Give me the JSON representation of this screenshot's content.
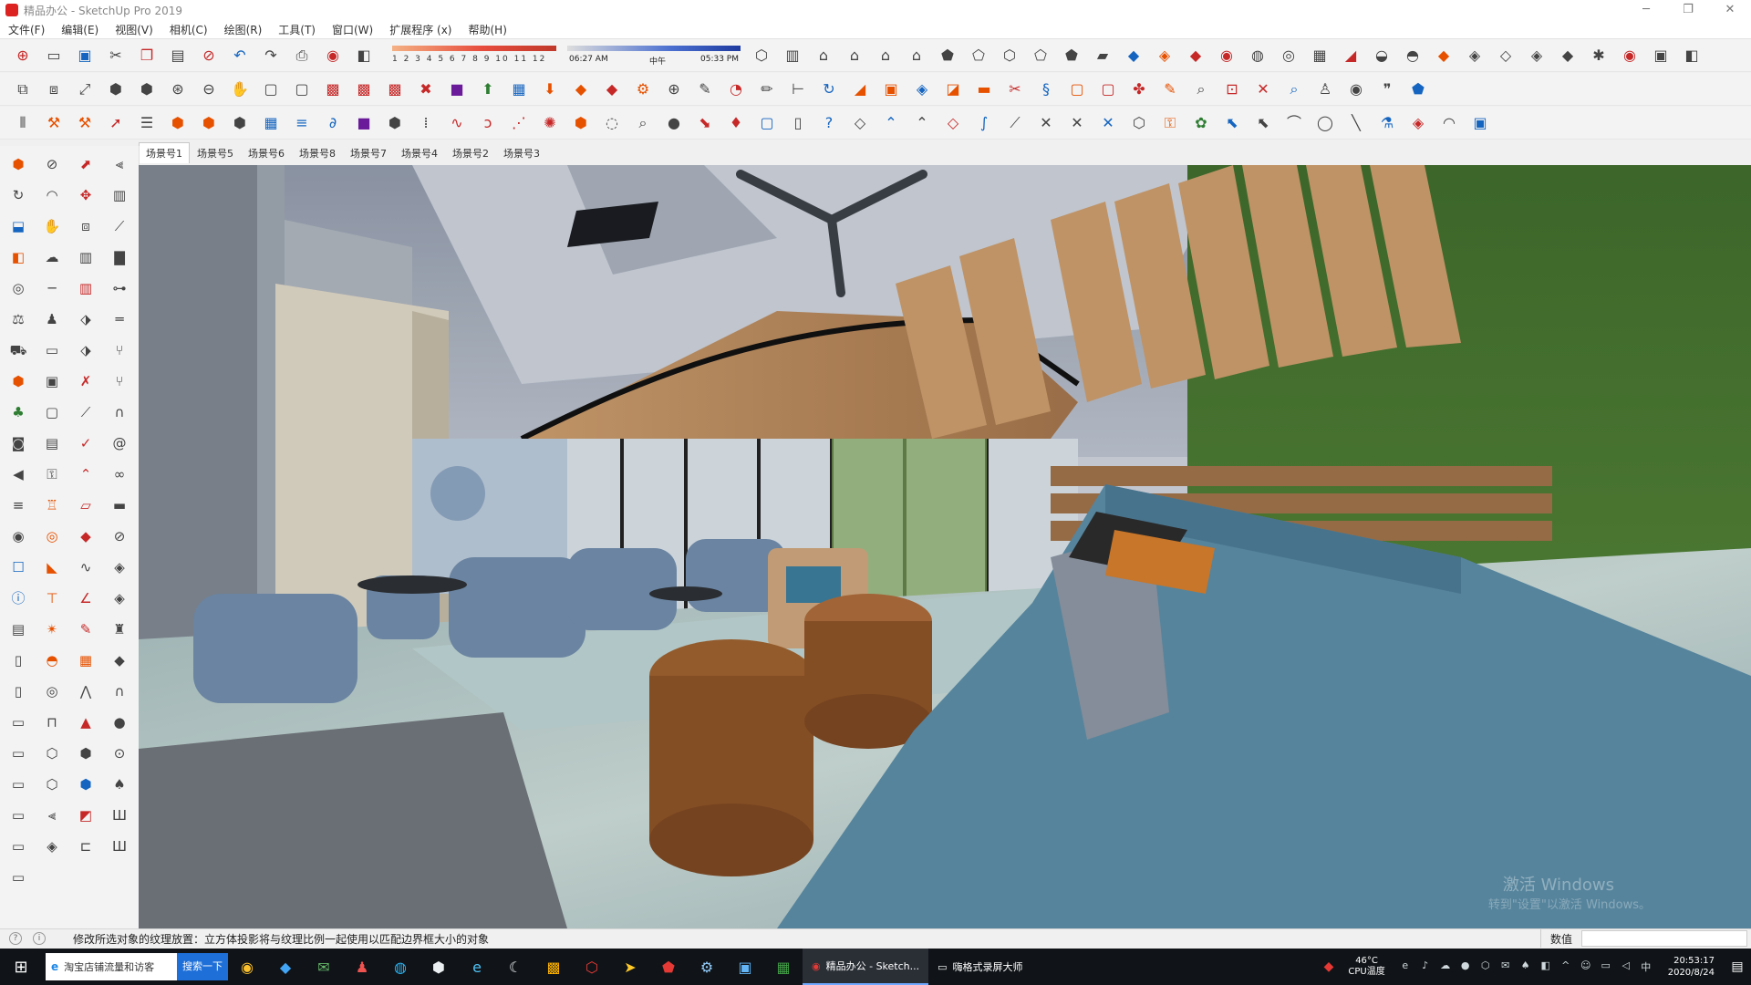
{
  "window": {
    "title": "精品办公 - SketchUp Pro 2019",
    "min": "─",
    "max": "❐",
    "close": "✕"
  },
  "menu": [
    "文件(F)",
    "编辑(E)",
    "视图(V)",
    "相机(C)",
    "绘图(R)",
    "工具(T)",
    "窗口(W)",
    "扩展程序 (x)",
    "帮助(H)"
  ],
  "shadow": {
    "months": "1 2 3 4 5 6 7 8 9 10 11 12",
    "time_start": "06:27 AM",
    "time_mid": "中午",
    "time_end": "05:33 PM"
  },
  "scenes": [
    "场景号1",
    "场景号5",
    "场景号6",
    "场景号8",
    "场景号7",
    "场景号4",
    "场景号2",
    "场景号3"
  ],
  "status": {
    "message": "修改所选对象的纹理放置：立方体投影将与纹理比例一起使用以匹配边界框大小的对象",
    "measure_label": "数值"
  },
  "watermark": {
    "line1": "激活 Windows",
    "line2": "转到\"设置\"以激活 Windows。"
  },
  "taskbar": {
    "search_text": "淘宝店铺流量和访客",
    "search_button": "搜索一下",
    "active_task": "精品办公 - Sketch...",
    "recorder_task": "嗨格式录屏大师",
    "temp": "46°C",
    "cpu_label": "CPU温度",
    "time": "20:53:17",
    "date": "2020/8/24"
  }
}
